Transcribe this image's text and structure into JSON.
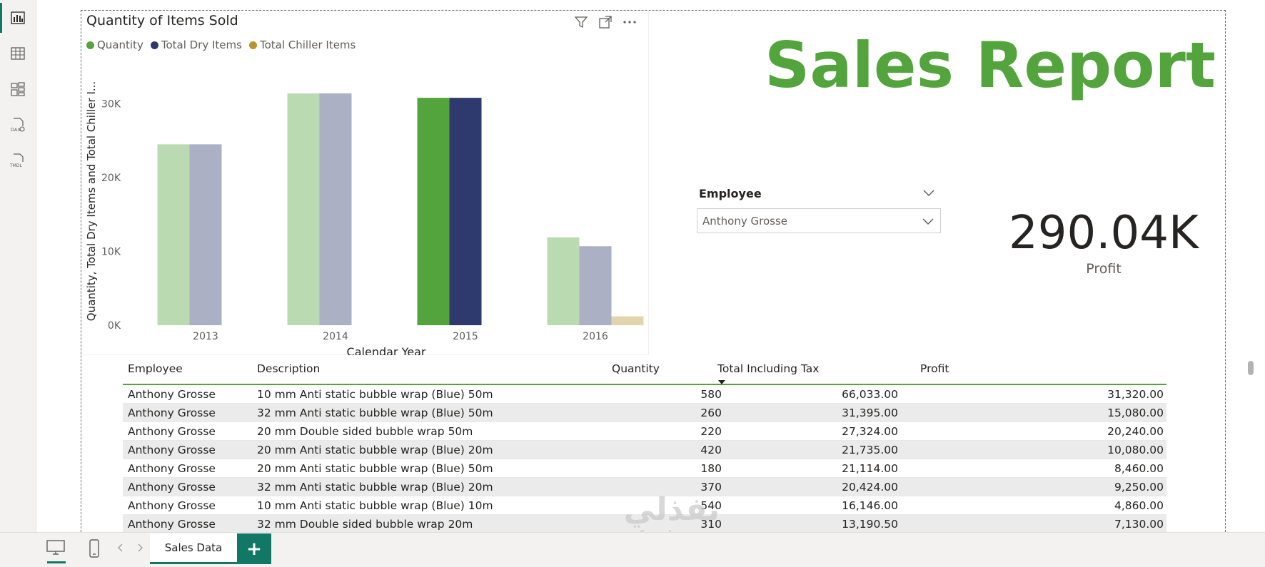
{
  "nav": {
    "items": [
      {
        "name": "report-view"
      },
      {
        "name": "table-view"
      },
      {
        "name": "model-view"
      },
      {
        "name": "dax-query-view"
      },
      {
        "name": "tmdl-view"
      }
    ]
  },
  "chart": {
    "title": "Quantity of Items Sold",
    "legend": [
      {
        "label": "Quantity",
        "color": "#53a43d"
      },
      {
        "label": "Total Dry Items",
        "color": "#2e3a6e"
      },
      {
        "label": "Total Chiller Items",
        "color": "#b8962e"
      }
    ]
  },
  "chart_data": {
    "type": "bar",
    "title": "Quantity of Items Sold",
    "xlabel": "Calendar Year",
    "ylabel": "Quantity, Total Dry Items and Total Chiller I...",
    "categories": [
      "2013",
      "2014",
      "2015",
      "2016"
    ],
    "highlighted_category": "2015",
    "series": [
      {
        "name": "Quantity",
        "color": "#53a43d",
        "values": [
          24500,
          31400,
          30800,
          11900
        ]
      },
      {
        "name": "Total Dry Items",
        "color": "#2e3a6e",
        "values": [
          24500,
          31400,
          30800,
          10700
        ]
      },
      {
        "name": "Total Chiller Items",
        "color": "#b8962e",
        "values": [
          0,
          0,
          0,
          1200
        ]
      }
    ],
    "ylim": [
      0,
      34000
    ],
    "yticks": [
      "0K",
      "10K",
      "20K",
      "30K"
    ],
    "ytick_values": [
      0,
      10000,
      20000,
      30000
    ],
    "legend_position": "top-left"
  },
  "report": {
    "title": "Sales Report"
  },
  "slicer": {
    "title": "Employee",
    "selected": "Anthony Grosse"
  },
  "card": {
    "value": "290.04K",
    "label": "Profit"
  },
  "table": {
    "columns": [
      "Employee",
      "Description",
      "Quantity",
      "Total Including Tax",
      "Profit"
    ],
    "rows": [
      [
        "Anthony Grosse",
        "10 mm Anti static bubble wrap (Blue) 50m",
        "580",
        "66,033.00",
        "31,320.00"
      ],
      [
        "Anthony Grosse",
        "32 mm Anti static bubble wrap (Blue) 50m",
        "260",
        "31,395.00",
        "15,080.00"
      ],
      [
        "Anthony Grosse",
        "20 mm Double sided bubble wrap 50m",
        "220",
        "27,324.00",
        "20,240.00"
      ],
      [
        "Anthony Grosse",
        "20 mm Anti static bubble wrap (Blue) 20m",
        "420",
        "21,735.00",
        "10,080.00"
      ],
      [
        "Anthony Grosse",
        "20 mm Anti static bubble wrap (Blue) 50m",
        "180",
        "21,114.00",
        "8,460.00"
      ],
      [
        "Anthony Grosse",
        "32 mm Anti static bubble wrap (Blue) 20m",
        "370",
        "20,424.00",
        "9,250.00"
      ],
      [
        "Anthony Grosse",
        "10 mm Anti static bubble wrap (Blue) 10m",
        "540",
        "16,146.00",
        "4,860.00"
      ],
      [
        "Anthony Grosse",
        "32 mm Double sided bubble wrap 20m",
        "310",
        "13,190.50",
        "7,130.00"
      ]
    ]
  },
  "pages": {
    "tabs": [
      "Sales Data"
    ],
    "add_label": "+"
  },
  "watermark": {
    "arabic": "نفذلي",
    "latin": "nafezly.com"
  }
}
